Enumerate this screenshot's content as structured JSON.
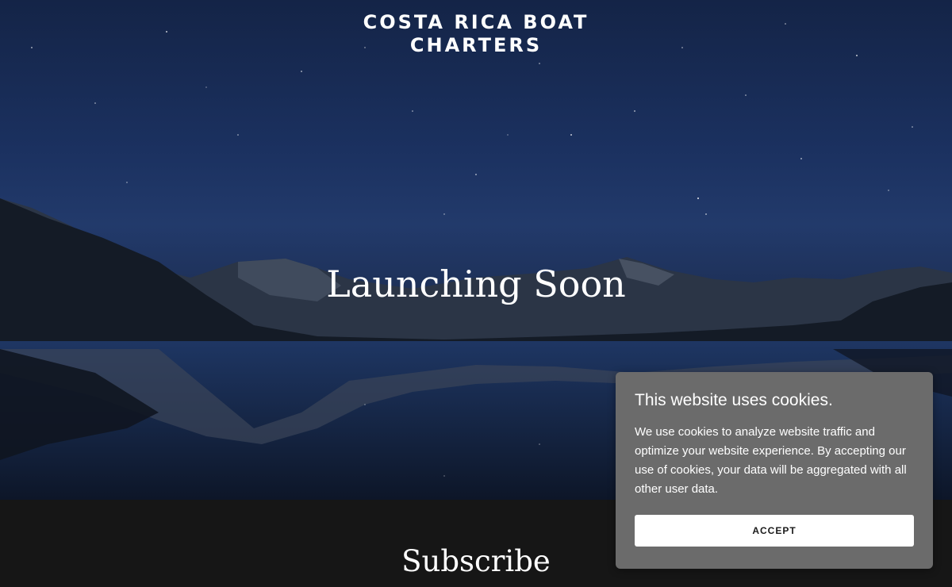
{
  "site": {
    "title": "COSTA RICA BOAT CHARTERS"
  },
  "hero": {
    "headline": "Launching Soon",
    "background": "night-sky-mountain-lake-photo"
  },
  "subscribe": {
    "heading": "Subscribe"
  },
  "cookie_banner": {
    "title": "This website uses cookies.",
    "body": "We use cookies to analyze website traffic and optimize your website experience. By accepting our use of cookies, your data will be aggregated with all other user data.",
    "accept_label": "ACCEPT"
  },
  "colors": {
    "sky_top": "#142447",
    "sky_mid": "#223a6b",
    "footer_bg": "#161616",
    "cookie_bg": "#6b6b6b",
    "button_bg": "#ffffff"
  }
}
